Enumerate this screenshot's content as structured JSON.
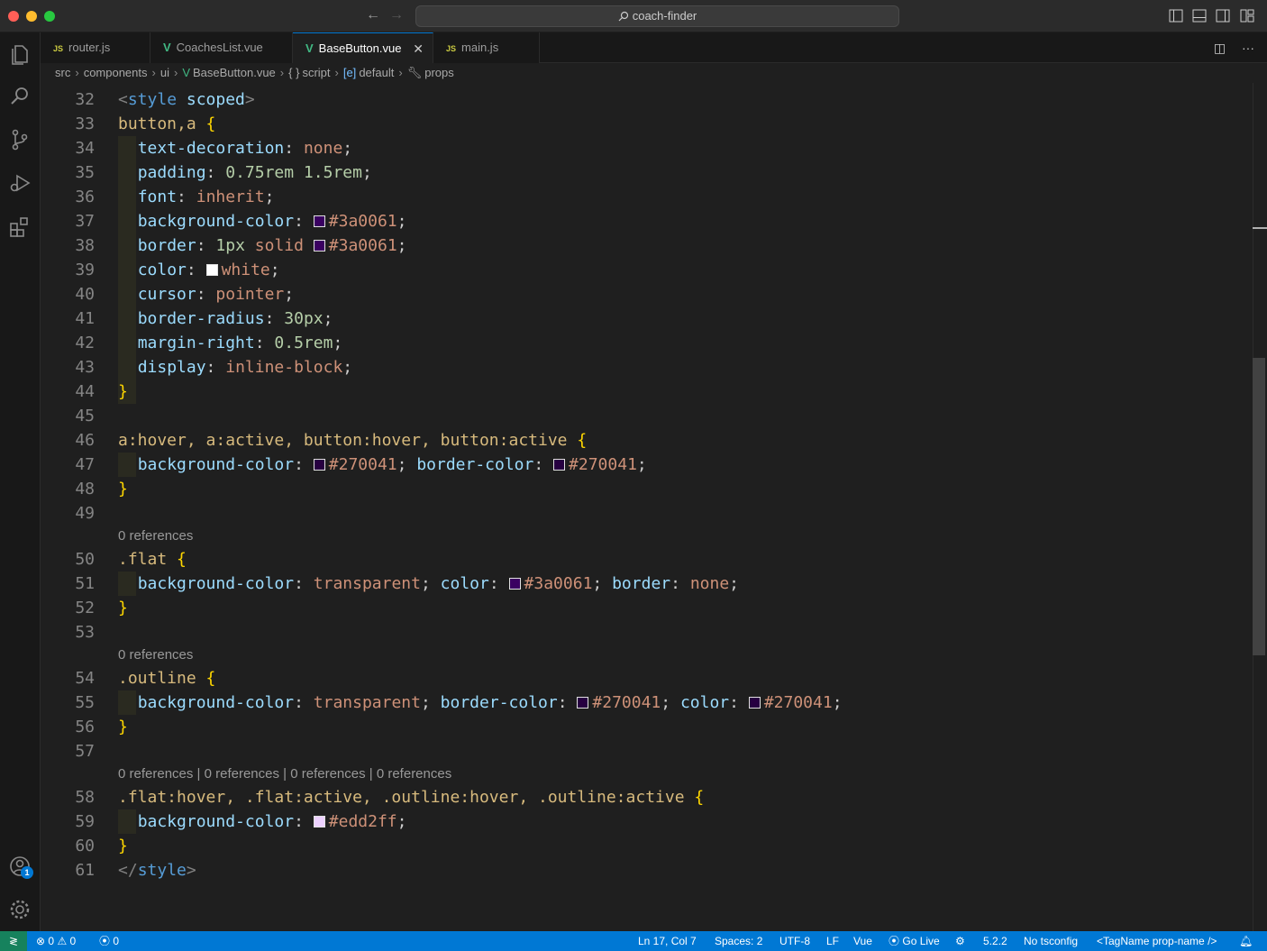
{
  "window": {
    "title": "coach-finder"
  },
  "tabs": [
    {
      "label": "router.js",
      "icon": "js-icon",
      "active": false
    },
    {
      "label": "CoachesList.vue",
      "icon": "vue-icon",
      "active": false
    },
    {
      "label": "BaseButton.vue",
      "icon": "vue-icon",
      "active": true
    },
    {
      "label": "main.js",
      "icon": "js-icon",
      "active": false
    }
  ],
  "breadcrumb": [
    "src",
    "components",
    "ui",
    "BaseButton.vue",
    "script",
    "default",
    "props"
  ],
  "breadcrumb_icons": {
    "script": "{ }",
    "default": "[e]",
    "props": "wrench-icon"
  },
  "codelens": {
    "a": "0 references",
    "b": "0 references",
    "c": "0 references | 0 references | 0 references | 0 references"
  },
  "line_numbers": [
    "32",
    "33",
    "34",
    "35",
    "36",
    "37",
    "38",
    "39",
    "40",
    "41",
    "42",
    "43",
    "44",
    "45",
    "46",
    "47",
    "48",
    "49",
    "50",
    "51",
    "52",
    "53",
    "54",
    "55",
    "56",
    "57",
    "58",
    "59",
    "60",
    "61"
  ],
  "colors": {
    "accent": "#0078d4",
    "swatch_3a0061": "#3a0061",
    "swatch_270041": "#270041",
    "swatch_white": "#ffffff",
    "swatch_edd2ff": "#edd2ff"
  },
  "code": {
    "l32": {
      "open": "<",
      "tag": "style",
      "attr": "scoped",
      "close": ">"
    },
    "l33": {
      "sel": "button,a",
      "brace": "{"
    },
    "l34": {
      "prop": "text-decoration",
      "val": "none"
    },
    "l35": {
      "prop": "padding",
      "val": "0.75rem 1.5rem"
    },
    "l36": {
      "prop": "font",
      "val": "inherit"
    },
    "l37": {
      "prop": "background-color",
      "val": "#3a0061"
    },
    "l38": {
      "prop": "border",
      "num": "1px",
      "val1": "solid",
      "val": "#3a0061"
    },
    "l39": {
      "prop": "color",
      "val": "white"
    },
    "l40": {
      "prop": "cursor",
      "val": "pointer"
    },
    "l41": {
      "prop": "border-radius",
      "val": "30px"
    },
    "l42": {
      "prop": "margin-right",
      "val": "0.5rem"
    },
    "l43": {
      "prop": "display",
      "val": "inline-block"
    },
    "l44": {
      "brace": "}"
    },
    "l46": {
      "sel": "a:hover, a:active, button:hover, button:active",
      "brace": "{"
    },
    "l47": {
      "prop1": "background-color",
      "val1": "#270041",
      "prop2": "border-color",
      "val2": "#270041"
    },
    "l48": {
      "brace": "}"
    },
    "l50": {
      "sel": ".flat",
      "brace": "{"
    },
    "l51": {
      "prop1": "background-color",
      "val1": "transparent",
      "prop2": "color",
      "val2": "#3a0061",
      "prop3": "border",
      "val3": "none"
    },
    "l52": {
      "brace": "}"
    },
    "l54": {
      "sel": ".outline",
      "brace": "{"
    },
    "l55": {
      "prop1": "background-color",
      "val1": "transparent",
      "prop2": "border-color",
      "val2": "#270041",
      "prop3": "color",
      "val3": "#270041"
    },
    "l56": {
      "brace": "}"
    },
    "l58": {
      "sel": ".flat:hover, .flat:active, .outline:hover, .outline:active",
      "brace": "{"
    },
    "l59": {
      "prop": "background-color",
      "val": "#edd2ff"
    },
    "l60": {
      "brace": "}"
    },
    "l61": {
      "open": "</",
      "tag": "style",
      "close": ">"
    }
  },
  "status": {
    "errors": "0",
    "warnings": "0",
    "ports": "0",
    "position": "Ln 17, Col 7",
    "spaces": "Spaces: 2",
    "encoding": "UTF-8",
    "eol": "LF",
    "language": "Vue",
    "golive": "Go Live",
    "version": "5.2.2",
    "tsconfig": "No tsconfig",
    "tagname": "<TagName prop-name />"
  },
  "accounts_badge": "1"
}
